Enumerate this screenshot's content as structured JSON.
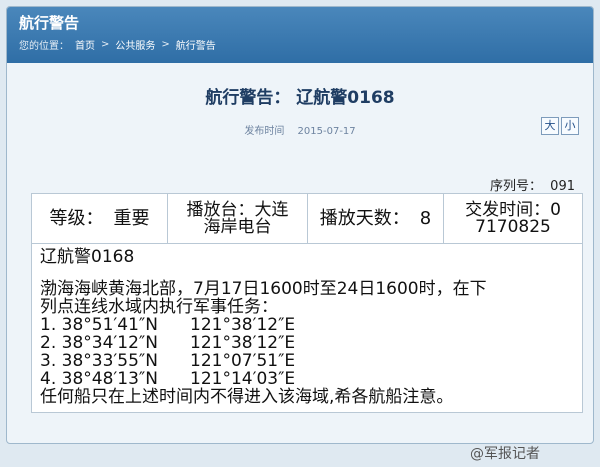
{
  "header": {
    "title": "航行警告",
    "breadcrumb_prefix": "您的位置：",
    "crumbs": [
      "首页",
      "公共服务",
      "航行警告"
    ],
    "separator": ">"
  },
  "doc": {
    "title": "航行警告：  辽航警0168",
    "meta_label": "发布时间",
    "date": "2015-07-17",
    "font_large": "大",
    "font_small": "小"
  },
  "serial": {
    "label": "序列号：",
    "value": "091"
  },
  "table": {
    "grade_label": "等级：",
    "grade_value": "重要",
    "station_line1": "播放台：大连",
    "station_line2": "海岸电台",
    "days_label": "播放天数：",
    "days_value": "8",
    "issued_line1": "交发时间：0",
    "issued_line2": "7170825"
  },
  "content": {
    "code": "辽航警0168",
    "text1": "渤海海峡黄海北部，7月17日1600时至24日1600时，在下",
    "text2": "列点连线水域内执行军事任务：",
    "points": [
      {
        "lat": "1. 38°51′41″N",
        "lon": "121°38′12″E"
      },
      {
        "lat": "2. 38°34′12″N",
        "lon": "121°38′12″E"
      },
      {
        "lat": "3. 38°33′55″N",
        "lon": "121°07′51″E"
      },
      {
        "lat": "4. 38°48′13″N",
        "lon": "121°14′03″E"
      }
    ],
    "notice": "任何船只在上述时间内不得进入该海域,希各航船注意。"
  },
  "watermark": "@军报记者"
}
